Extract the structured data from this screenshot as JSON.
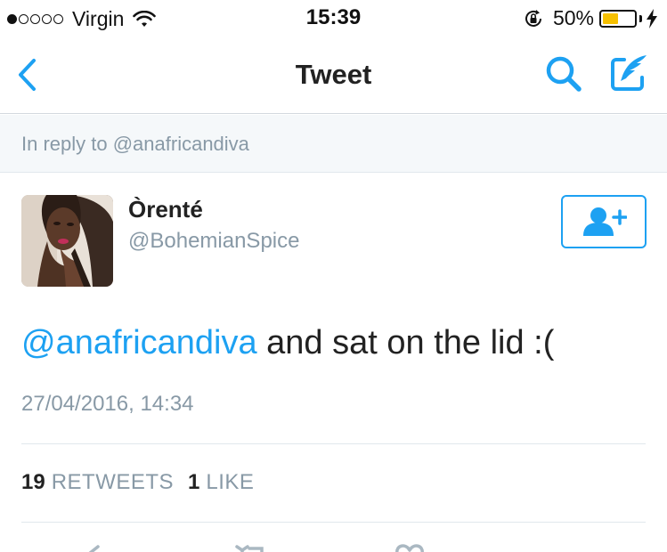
{
  "status_bar": {
    "carrier": "Virgin",
    "signal_bars_filled": 1,
    "signal_bars_total": 5,
    "time": "15:39",
    "battery_percent": "50%",
    "battery_level": 0.5,
    "battery_color": "#f6c000",
    "icons": [
      "wifi-icon",
      "rotation-lock-icon",
      "battery-icon",
      "charging-bolt-icon"
    ]
  },
  "nav": {
    "title": "Tweet",
    "accent_color": "#1da1f2",
    "icons": [
      "back-chevron-icon",
      "search-icon",
      "compose-tweet-icon"
    ]
  },
  "reply_context": {
    "text": "In reply to @anafricandiva"
  },
  "author": {
    "display_name": "Òrenté",
    "handle": "@BohemianSpice",
    "follow_icon": "add-user-icon"
  },
  "tweet": {
    "mention": "@anafricandiva",
    "body": " and sat on the lid :(",
    "timestamp": "27/04/2016, 14:34"
  },
  "stats": {
    "retweets_count": "19",
    "retweets_label": "RETWEETS",
    "likes_count": "1",
    "likes_label": "LIKE"
  },
  "actions": {
    "icons": [
      "reply-icon",
      "retweet-icon",
      "like-icon"
    ]
  }
}
